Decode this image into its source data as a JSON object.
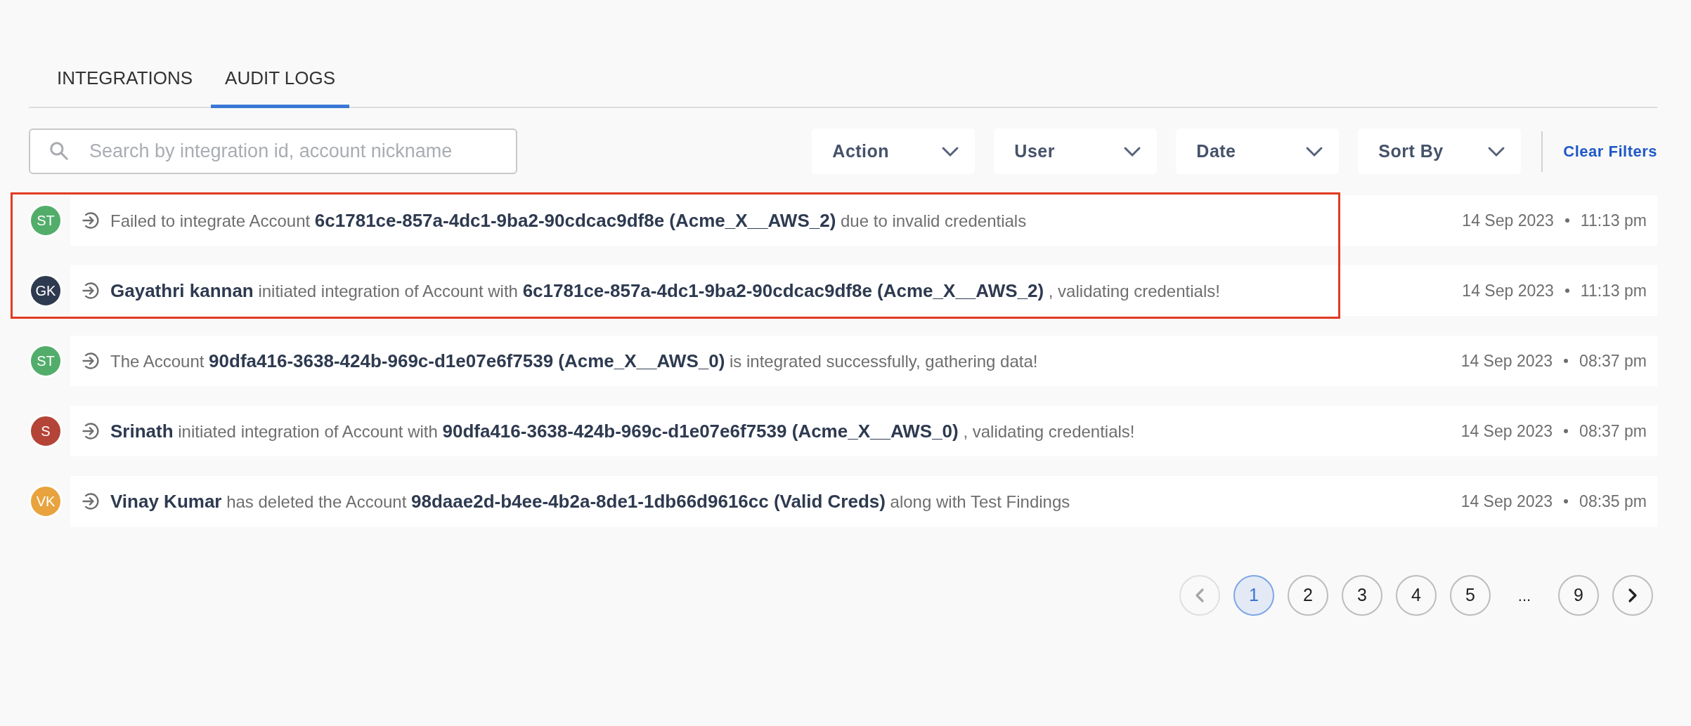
{
  "tabs": [
    {
      "label": "INTEGRATIONS",
      "selected": false
    },
    {
      "label": "AUDIT LOGS",
      "selected": true
    }
  ],
  "search": {
    "placeholder": "Search by integration id, account nickname"
  },
  "filters": [
    {
      "label": "Action"
    },
    {
      "label": "User"
    },
    {
      "label": "Date"
    },
    {
      "label": "Sort By"
    }
  ],
  "clear_filters": "Clear Filters",
  "logs": [
    {
      "initials": "ST",
      "color": "#52ad6b",
      "message": "Failed to integrate Account **6c1781ce-857a-4dc1-9ba2-90cdcac9df8e (Acme_X__AWS_2)** due to invalid credentials",
      "date": "14 Sep 2023",
      "time": "11:13 pm",
      "highlighted": true
    },
    {
      "initials": "GK",
      "color": "#2e3a50",
      "message": "**Gayathri kannan** initiated integration of Account with **6c1781ce-857a-4dc1-9ba2-90cdcac9df8e (Acme_X__AWS_2)** , validating credentials!",
      "date": "14 Sep 2023",
      "time": "11:13 pm",
      "highlighted": true
    },
    {
      "initials": "ST",
      "color": "#52ad6b",
      "message": "The Account **90dfa416-3638-424b-969c-d1e07e6f7539 (Acme_X__AWS_0)** is integrated successfully, gathering data!",
      "date": "14 Sep 2023",
      "time": "08:37 pm",
      "highlighted": false
    },
    {
      "initials": "S",
      "color": "#b44437",
      "message": "**Srinath** initiated integration of Account with **90dfa416-3638-424b-969c-d1e07e6f7539 (Acme_X__AWS_0)** , validating credentials!",
      "date": "14 Sep 2023",
      "time": "08:37 pm",
      "highlighted": false
    },
    {
      "initials": "VK",
      "color": "#e8a33e",
      "message": "**Vinay Kumar** has deleted the Account **98daae2d-b4ee-4b2a-8de1-1db66d9616cc (Valid Creds)** along with Test Findings",
      "date": "14 Sep 2023",
      "time": "08:35 pm",
      "highlighted": false
    }
  ],
  "pagination": {
    "prev": {
      "disabled": true
    },
    "next": {
      "disabled": false
    },
    "items": [
      {
        "kind": "page",
        "label": "1",
        "selected": true
      },
      {
        "kind": "page",
        "label": "2",
        "selected": false
      },
      {
        "kind": "page",
        "label": "3",
        "selected": false
      },
      {
        "kind": "page",
        "label": "4",
        "selected": false
      },
      {
        "kind": "page",
        "label": "5",
        "selected": false
      },
      {
        "kind": "ellipsis",
        "label": "..."
      },
      {
        "kind": "page",
        "label": "9",
        "selected": false
      }
    ]
  }
}
